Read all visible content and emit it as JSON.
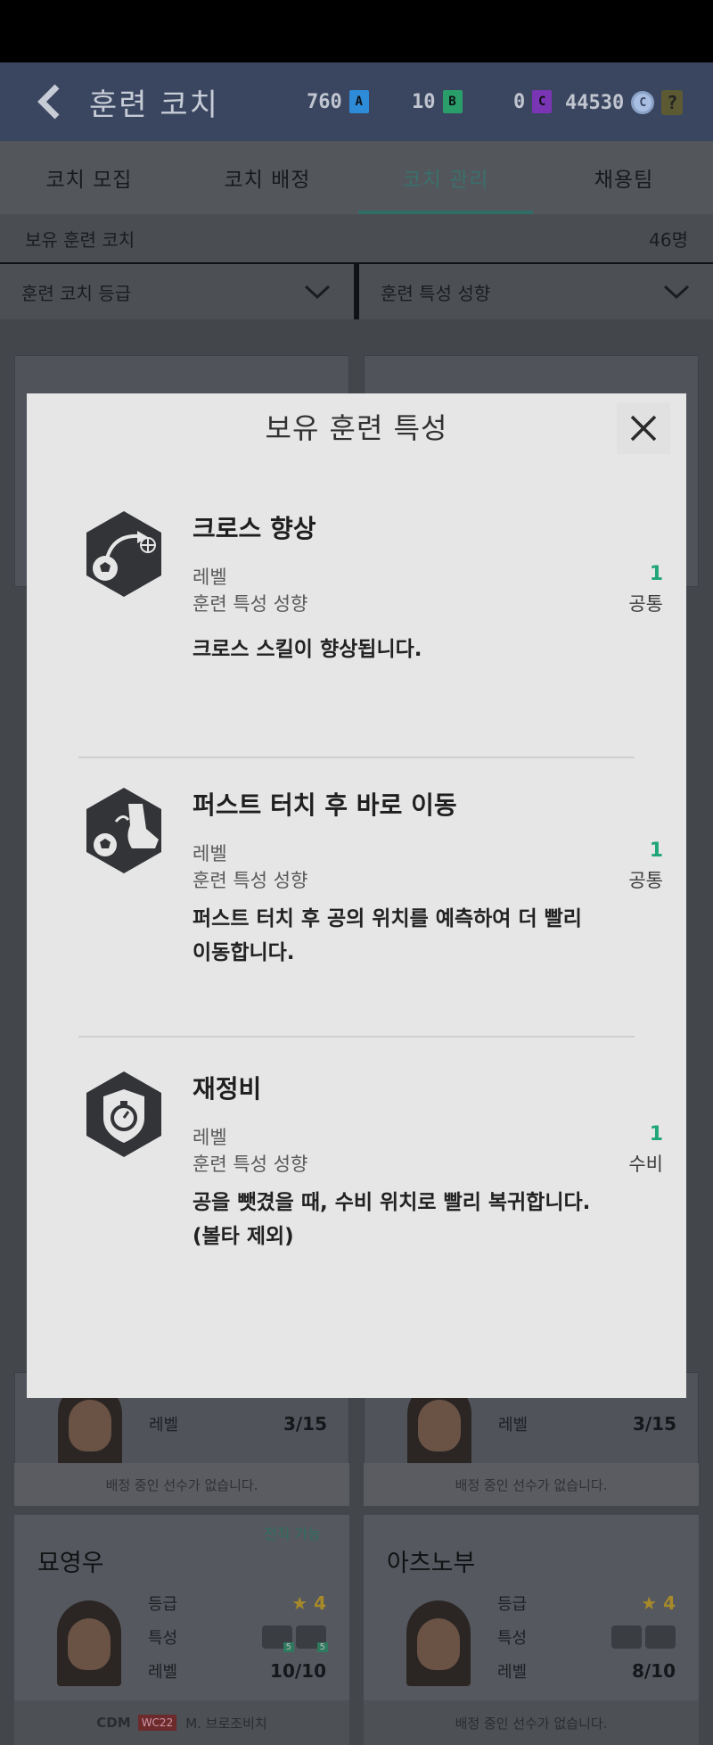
{
  "header": {
    "title": "훈련 코치",
    "currencies": [
      {
        "value": "760",
        "badge": "A",
        "color": "#2d8bd8"
      },
      {
        "value": "10",
        "badge": "B",
        "color": "#2a9e6a"
      },
      {
        "value": "0",
        "badge": "C",
        "color": "#7a35b5"
      }
    ],
    "fc_value": "44530",
    "fc_badge": "C",
    "help_label": "?"
  },
  "tabs": [
    {
      "label": "코치 모집"
    },
    {
      "label": "코치 배정"
    },
    {
      "label": "코치 관리",
      "active": true
    },
    {
      "label": "채용팀"
    }
  ],
  "owned": {
    "label": "보유 훈련 코치",
    "count": "46명"
  },
  "filters": [
    {
      "label": "훈련 코치 등급"
    },
    {
      "label": "훈련 특성 성향"
    }
  ],
  "background_cards": [
    {
      "level_label": "레벨",
      "level_value": "3/15",
      "footer": "배정 중인 선수가 없습니다."
    },
    {
      "level_label": "레벨",
      "level_value": "3/15",
      "footer": "배정 중인 선수가 없습니다."
    }
  ],
  "bottom_cards": [
    {
      "name": "묘영우",
      "transfer_badge": "전직 가능",
      "grade_label": "등급",
      "grade_value": "★ 4",
      "trait_label": "특성",
      "trait_levels": [
        "5",
        "5"
      ],
      "level_label": "레벨",
      "level_value": "10/10",
      "footer_position": "CDM",
      "footer_tag": "WC22",
      "footer_player": "M. 브로조비치"
    },
    {
      "name": "아츠노부",
      "grade_label": "등급",
      "grade_value": "★ 4",
      "trait_label": "특성",
      "trait_levels": [
        "",
        ""
      ],
      "level_label": "레벨",
      "level_value": "8/10",
      "footer_text": "배정 중인 선수가 없습니다."
    }
  ],
  "modal": {
    "title": "보유 훈련 특성",
    "traits": [
      {
        "name": "크로스 향상",
        "icon": "cross-improve-icon",
        "level_label": "레벨",
        "level_value": "1",
        "tendency_label": "훈련 특성 성향",
        "tendency_value": "공통",
        "description": "크로스 스킬이 향상됩니다."
      },
      {
        "name": "퍼스트 터치 후 바로 이동",
        "icon": "first-touch-icon",
        "level_label": "레벨",
        "level_value": "1",
        "tendency_label": "훈련 특성 성향",
        "tendency_value": "공통",
        "description_line1": "퍼스트 터치 후 공의 위치를 예측하여 더 빨리",
        "description_line2": "이동합니다."
      },
      {
        "name": "재정비",
        "icon": "stopwatch-shield-icon",
        "level_label": "레벨",
        "level_value": "1",
        "tendency_label": "훈련 특성 성향",
        "tendency_value": "수비",
        "description_line1": "공을 뺏겼을 때, 수비 위치로 빨리 복귀합니다.",
        "description_line2": "(볼타 제외)"
      }
    ]
  }
}
